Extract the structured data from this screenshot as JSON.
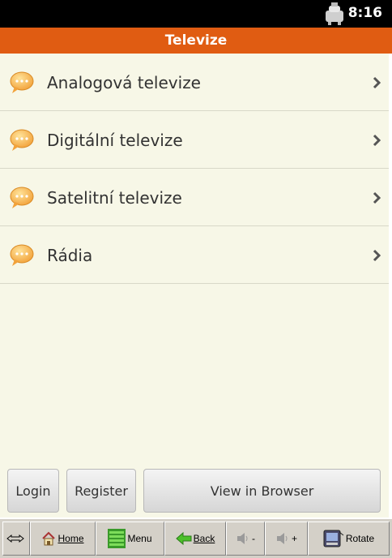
{
  "status": {
    "time": "8:16"
  },
  "header": {
    "title": "Televize"
  },
  "list": {
    "items": [
      {
        "label": "Analogová televize"
      },
      {
        "label": "Digitální televize"
      },
      {
        "label": "Satelitní televize"
      },
      {
        "label": "Rádia"
      }
    ]
  },
  "buttons": {
    "login": "Login",
    "register": "Register",
    "view_browser": "View in Browser"
  },
  "toolbar": {
    "home": "Home",
    "menu": "Menu",
    "back": "Back",
    "vol_down": "-",
    "vol_up": "+",
    "rotate": "Rotate"
  },
  "colors": {
    "accent": "#e05c12",
    "background": "#f7f7e7"
  }
}
